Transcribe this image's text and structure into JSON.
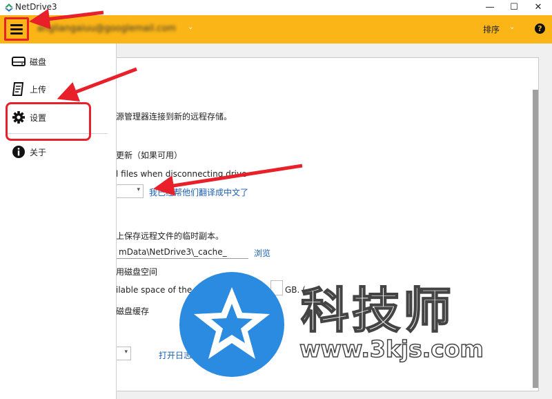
{
  "window": {
    "title": "NetDrive3",
    "minimize_glyph": "—",
    "maximize_glyph": "☐",
    "close_glyph": "✕"
  },
  "toolbar": {
    "account_email": "angliangaiuu@googlemail.com",
    "sort_label": "排序",
    "chevron_glyph": "⌄",
    "help_glyph": "?"
  },
  "sidebar": {
    "items": [
      {
        "label": "磁盘",
        "icon": "drive-icon"
      },
      {
        "label": "上传",
        "icon": "upload-icon"
      },
      {
        "label": "设置",
        "icon": "gear-icon"
      },
      {
        "label": "关于",
        "icon": "info-icon"
      }
    ]
  },
  "settings": {
    "explorer_text": "源管理器连接到新的远程存储。",
    "auto_update_text": "更新（如果可用）",
    "disconnect_text": "l files when disconnecting drive",
    "translate_link": "我已经帮他们翻译成中文了",
    "temp_copy_text": "上保存远程文件的临时副本。",
    "cache_path": "mData\\NetDrive3\\_cache_",
    "browse_link": "浏览",
    "disk_space_text": "用磁盘空间",
    "available_space_text": "ilable space of the ca",
    "unit_text": "GB. (",
    "disk_cache_text": "磁盘缓存",
    "open_log_link": "打开日志"
  },
  "watermark": {
    "brand_text": "科技师",
    "url_text": "www.3kjs.com"
  },
  "colors": {
    "accent": "#fbb516",
    "annotation_red": "#e8202a",
    "link_blue": "#1a5fb4",
    "watermark_blue": "#2b8be0"
  }
}
